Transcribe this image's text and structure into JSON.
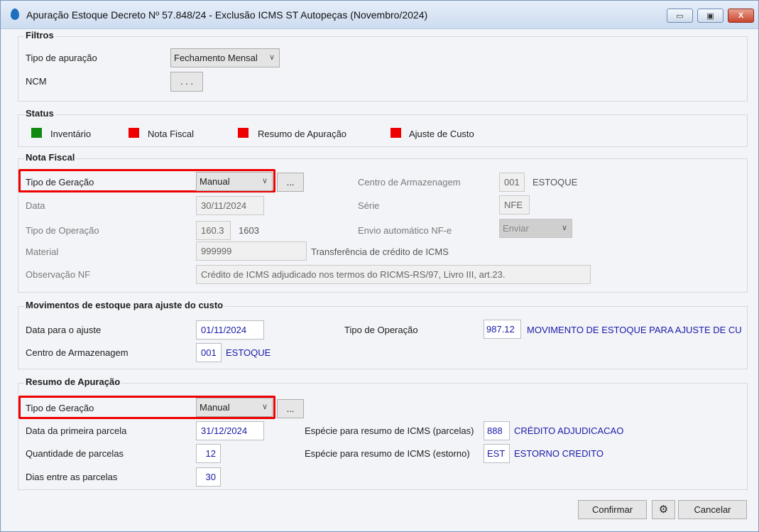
{
  "window": {
    "title": "Apuração Estoque Decreto Nº 57.848/24 - Exclusão ICMS ST Autopeças (Novembro/2024)",
    "minimize": "▭",
    "maximize": "▣",
    "close": "X"
  },
  "filtros": {
    "title": "Filtros",
    "tipo_apuracao_label": "Tipo de apuração",
    "tipo_apuracao_value": "Fechamento Mensal",
    "ncm_label": "NCM",
    "ncm_button": ". . ."
  },
  "status": {
    "title": "Status",
    "items": [
      {
        "label": "Inventário",
        "color": "#108a10"
      },
      {
        "label": "Nota Fiscal",
        "color": "#ee0000"
      },
      {
        "label": "Resumo de Apuração",
        "color": "#ee0000"
      },
      {
        "label": "Ajuste de Custo",
        "color": "#ee0000"
      }
    ]
  },
  "nota_fiscal": {
    "title": "Nota Fiscal",
    "tipo_geracao_label": "Tipo de Geração",
    "tipo_geracao_value": "Manual",
    "more_button": "...",
    "data_label": "Data",
    "data_value": "30/11/2024",
    "tipo_operacao_label": "Tipo de Operação",
    "tipo_operacao_value": "160.3",
    "tipo_operacao_desc": "1603",
    "material_label": "Material",
    "material_value": "999999",
    "material_desc": "Transferência de crédito de ICMS",
    "observacao_label": "Observação NF",
    "observacao_value": "Crédito de ICMS adjudicado nos termos do RICMS-RS/97, Livro III, art.23.",
    "centro_label": "Centro de Armazenagem",
    "centro_value": "001",
    "centro_desc": "ESTOQUE",
    "serie_label": "Série",
    "serie_value": "NFE",
    "envio_label": "Envio automático NF-e",
    "envio_value": "Enviar"
  },
  "movimentos": {
    "title": "Movimentos de estoque para ajuste do custo",
    "data_label": "Data para o ajuste",
    "data_value": "01/11/2024",
    "centro_label": "Centro de Armazenagem",
    "centro_value": "001",
    "centro_desc": "ESTOQUE",
    "tipo_operacao_label": "Tipo de Operação",
    "tipo_operacao_value": "987.12",
    "tipo_operacao_desc": "MOVIMENTO DE ESTOQUE PARA AJUSTE DE CU"
  },
  "resumo": {
    "title": "Resumo de Apuração",
    "tipo_geracao_label": "Tipo de Geração",
    "tipo_geracao_value": "Manual",
    "more_button": "...",
    "primeira_label": "Data da primeira parcela",
    "primeira_value": "31/12/2024",
    "qtd_label": "Quantidade de parcelas",
    "qtd_value": "12",
    "dias_label": "Dias entre as parcelas",
    "dias_value": "30",
    "especie_parcelas_label": "Espécie para resumo de ICMS (parcelas)",
    "especie_parcelas_value": "888",
    "especie_parcelas_desc": "CRÉDITO ADJUDICACAO",
    "especie_estorno_label": "Espécie para resumo de ICMS (estorno)",
    "especie_estorno_value": "EST",
    "especie_estorno_desc": "ESTORNO CREDITO"
  },
  "footer": {
    "confirm": "Confirmar",
    "settings_icon": "gear-icon",
    "cancel": "Cancelar"
  },
  "highlight_color": "#ee0000"
}
